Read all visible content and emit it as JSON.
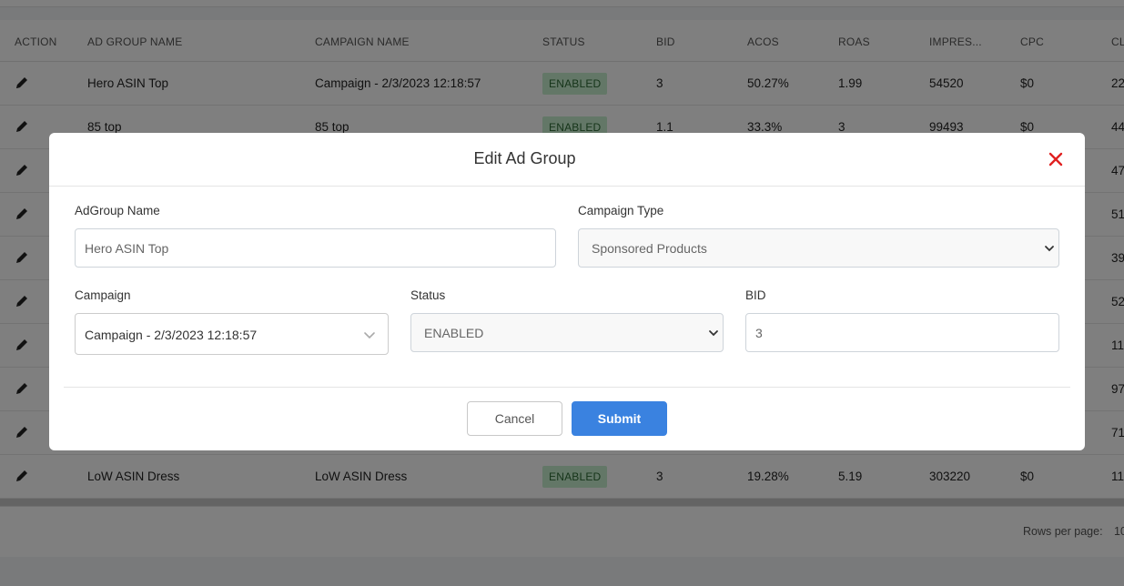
{
  "table": {
    "headers": [
      "ACTION",
      "AD GROUP NAME",
      "CAMPAIGN NAME",
      "STATUS",
      "BID",
      "ACOS",
      "ROAS",
      "IMPRES...",
      "CPC",
      "CL"
    ],
    "rows": [
      {
        "ad_group": "Hero ASIN Top",
        "campaign": "Campaign - 2/3/2023 12:18:57",
        "status": "ENABLED",
        "bid": "3",
        "acos": "50.27%",
        "roas": "1.99",
        "impressions": "54520",
        "cpc": "$0",
        "clicks": "22"
      },
      {
        "ad_group": "85 top",
        "campaign": "85 top",
        "status": "ENABLED",
        "bid": "1.1",
        "acos": "33.3%",
        "roas": "3",
        "impressions": "99493",
        "cpc": "$0",
        "clicks": "44"
      },
      {
        "clicks": "47"
      },
      {
        "clicks": "51"
      },
      {
        "clicks": "39"
      },
      {
        "clicks": "52"
      },
      {
        "clicks": "11"
      },
      {
        "clicks": "97"
      },
      {
        "clicks": "71"
      },
      {
        "ad_group": "LoW ASIN Dress",
        "campaign": "LoW ASIN Dress",
        "status": "ENABLED",
        "bid": "3",
        "acos": "19.28%",
        "roas": "5.19",
        "impressions": "303220",
        "cpc": "$0",
        "clicks": "11"
      }
    ],
    "rows_per_page_label": "Rows per page:",
    "rows_per_page_value": "10"
  },
  "modal": {
    "title": "Edit Ad Group",
    "adgroup_name_label": "AdGroup Name",
    "adgroup_name_value": "Hero ASIN Top",
    "campaign_type_label": "Campaign Type",
    "campaign_type_value": "Sponsored Products",
    "campaign_label": "Campaign",
    "campaign_value": "Campaign - 2/3/2023 12:18:57",
    "status_label": "Status",
    "status_value": "ENABLED",
    "bid_label": "BID",
    "bid_value": "3",
    "cancel_label": "Cancel",
    "submit_label": "Submit"
  },
  "colors": {
    "accent": "#3a82e0",
    "close": "#e02020",
    "badge_bg": "#c6efce",
    "badge_text": "#2d6a35"
  },
  "icons": {
    "edit": "pencil-icon",
    "close": "close-icon",
    "dropdown": "chevron-down-icon"
  }
}
